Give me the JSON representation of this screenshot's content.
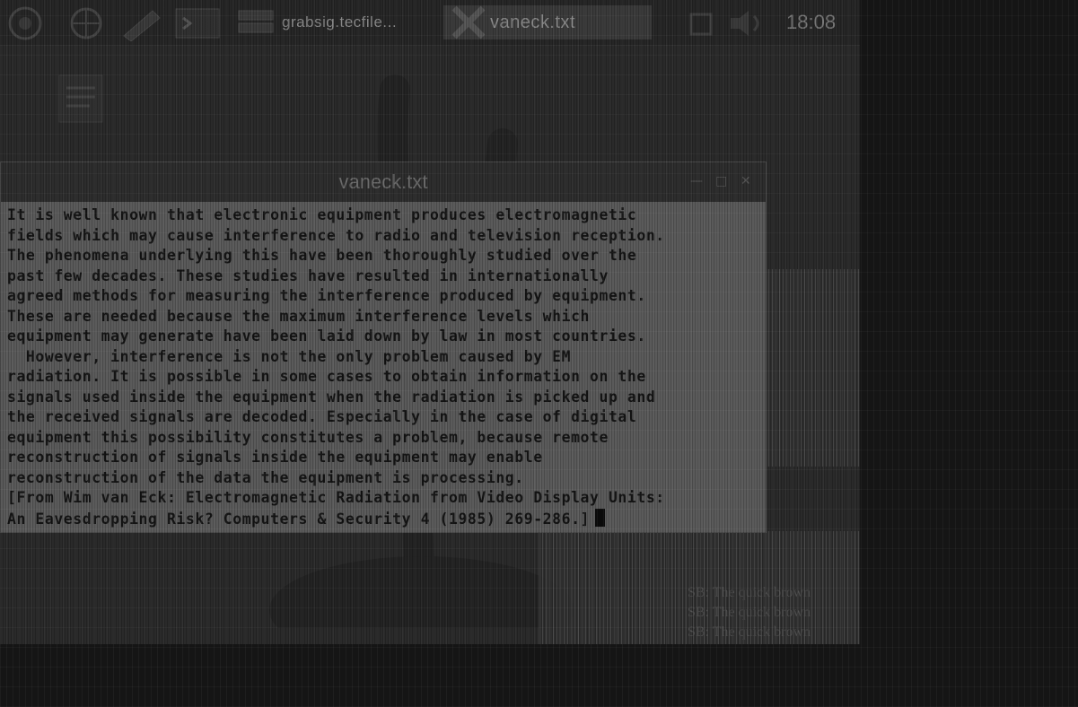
{
  "taskbar": {
    "buttons": [
      {
        "label": "grabsig.tecfile..."
      },
      {
        "label": "vaneck.txt"
      }
    ],
    "clock": "18:08"
  },
  "window": {
    "title": "vaneck.txt",
    "lines": [
      "It is well known that electronic equipment produces electromagnetic",
      "fields which may cause interference to radio and television reception.",
      "The phenomena underlying this have been thoroughly studied over the",
      "past few decades. These studies have resulted in internationally",
      "agreed methods for measuring the interference produced by equipment.",
      "These are needed because the maximum interference levels which",
      "equipment may generate have been laid down by law in most countries.",
      "  However, interference is not the only problem caused by EM",
      "radiation. It is possible in some cases to obtain information on the",
      "signals used inside the equipment when the radiation is picked up and",
      "the received signals are decoded. Especially in the case of digital",
      "equipment this possibility constitutes a problem, because remote",
      "reconstruction of signals inside the equipment may enable",
      "reconstruction of the data the equipment is processing.",
      "[From Wim van Eck: Electromagnetic Radiation from Video Display Units:",
      "An Eavesdropping Risk? Computers & Security 4 (1985) 269-286.]"
    ]
  },
  "background": {
    "lines": [
      "SB: The quick brown",
      "SB: The quick brown",
      "SB: The quick brown"
    ]
  }
}
